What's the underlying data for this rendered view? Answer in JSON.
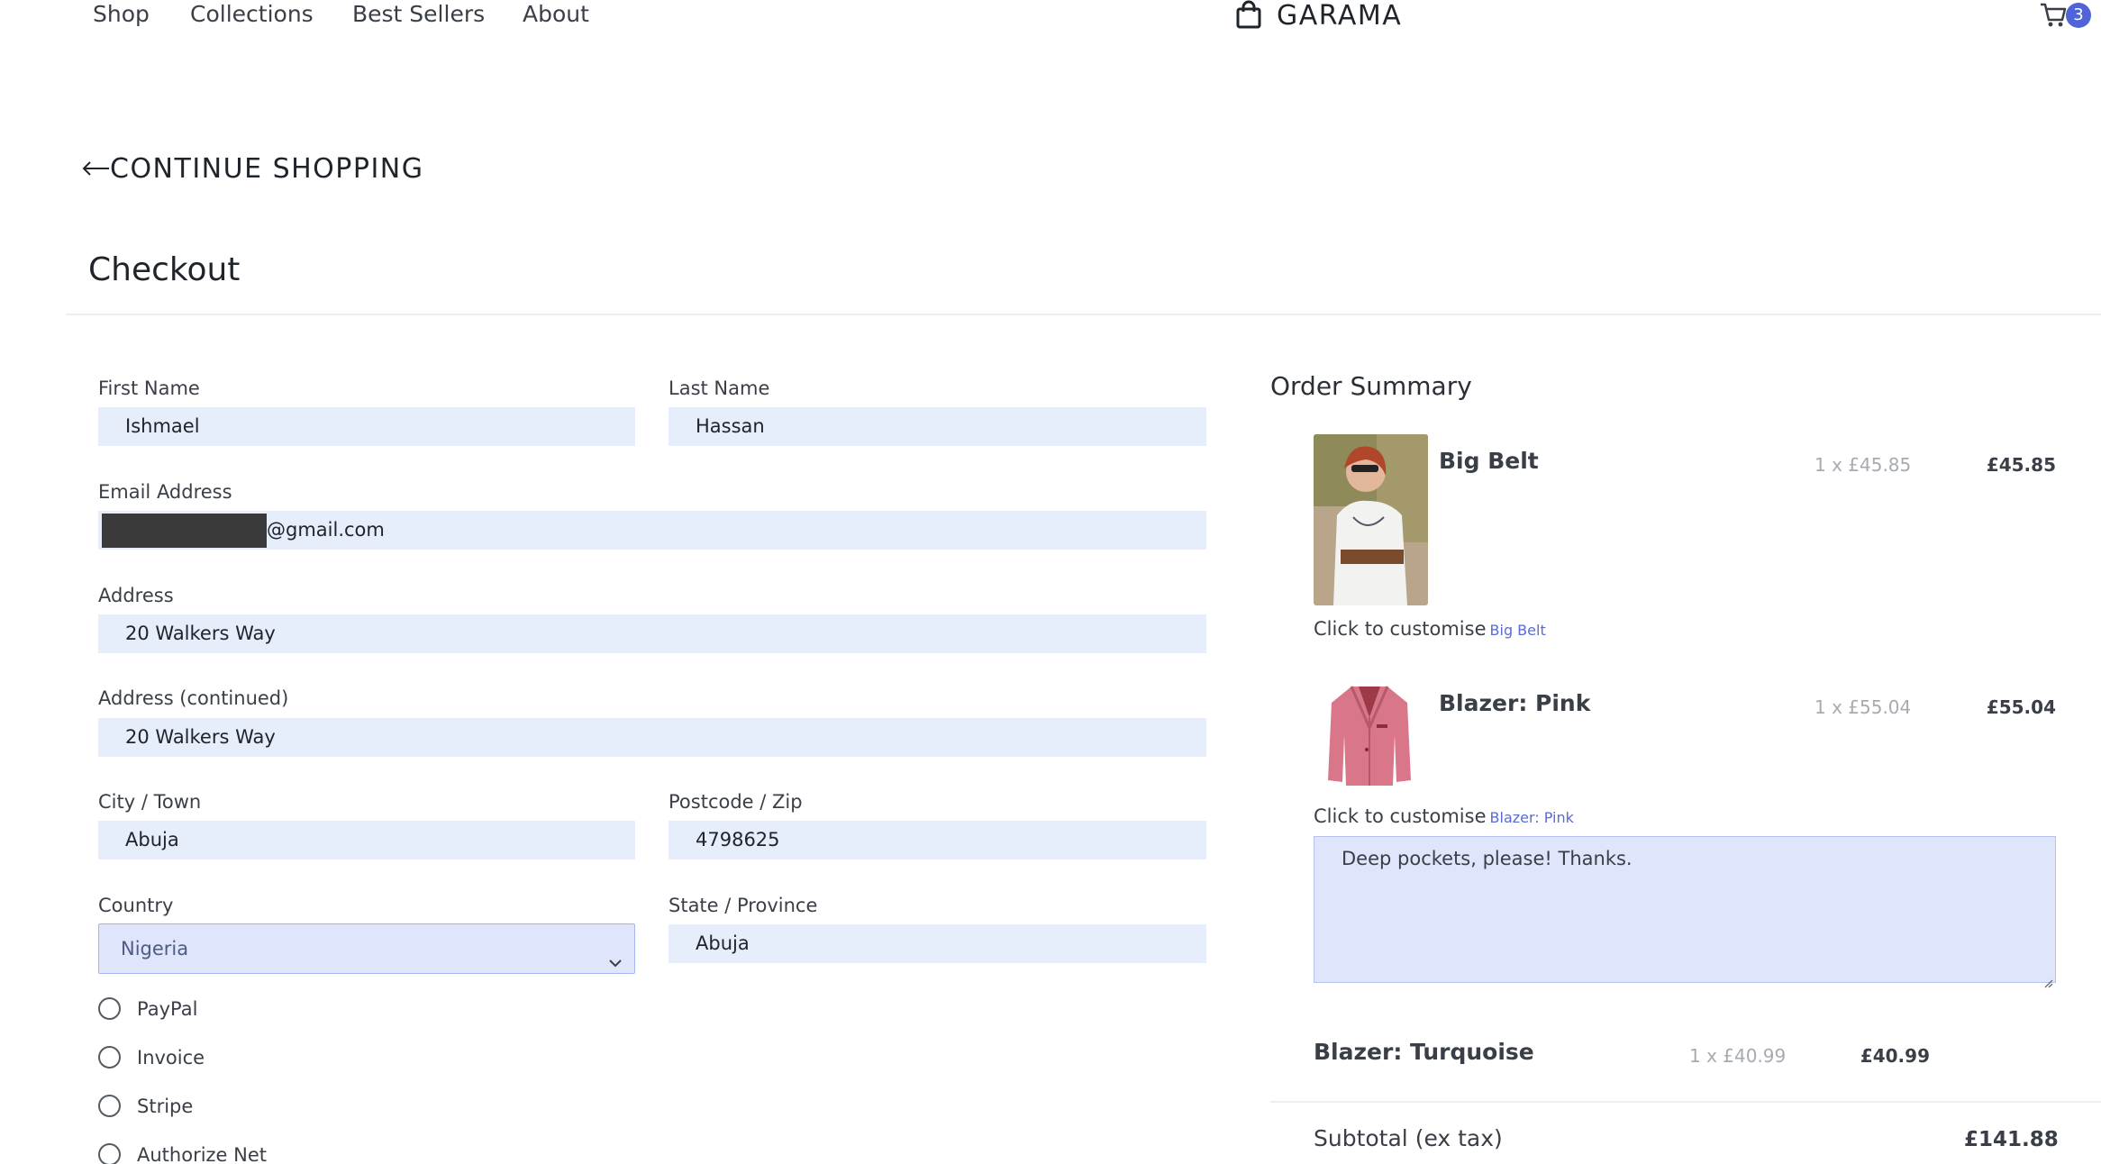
{
  "nav": {
    "links": [
      "Shop",
      "Collections",
      "Best Sellers",
      "About"
    ],
    "brand": "GARAMA",
    "cart_count": "3"
  },
  "continue_label": "CONTINUE SHOPPING",
  "page_title": "Checkout",
  "form": {
    "first_name": {
      "label": "First Name",
      "value": "Ishmael"
    },
    "last_name": {
      "label": "Last Name",
      "value": "Hassan"
    },
    "email": {
      "label": "Email Address",
      "value_suffix": "@gmail.com"
    },
    "address": {
      "label": "Address",
      "value": "20 Walkers Way"
    },
    "address2": {
      "label": "Address (continued)",
      "value": "20 Walkers Way"
    },
    "city": {
      "label": "City / Town",
      "value": "Abuja"
    },
    "postcode": {
      "label": "Postcode / Zip",
      "value": "4798625"
    },
    "country": {
      "label": "Country",
      "value": "Nigeria"
    },
    "state": {
      "label": "State / Province",
      "value": "Abuja"
    },
    "payment_methods": [
      "PayPal",
      "Invoice",
      "Stripe",
      "Authorize Net"
    ]
  },
  "summary": {
    "title": "Order Summary",
    "customise_prefix": "Click to customise",
    "items": [
      {
        "name": "Big Belt",
        "qty": "1 x £45.85",
        "total": "£45.85",
        "customise_link": "Big Belt"
      },
      {
        "name": "Blazer: Pink",
        "qty": "1 x £55.04",
        "total": "£55.04",
        "customise_link": "Blazer: Pink",
        "note": "Deep pockets, please! Thanks."
      },
      {
        "name": "Blazer: Turquoise",
        "qty": "1 x £40.99",
        "total": "£40.99"
      }
    ],
    "subtotal_label": "Subtotal (ex tax)",
    "subtotal_value": "£141.88"
  },
  "colors": {
    "accent": "#4f64d8",
    "field_bg": "#e6edfb",
    "link": "#5a6bd4"
  }
}
